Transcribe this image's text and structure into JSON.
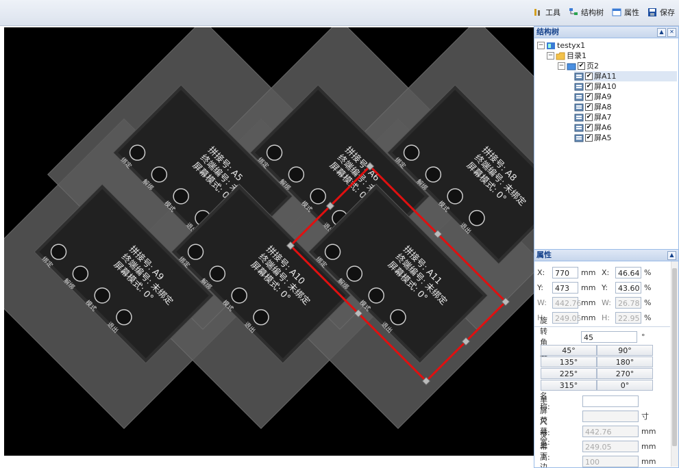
{
  "toolbar": {
    "tools_label": "工具",
    "tree_label": "结构树",
    "props_label": "属性",
    "save_label": "保存"
  },
  "structure_panel": {
    "title": "结构树",
    "root": "testyx1",
    "directory": "目录1",
    "page": "页2",
    "screens": [
      "屏A11",
      "屏A10",
      "屏A9",
      "屏A8",
      "屏A7",
      "屏A6",
      "屏A5"
    ]
  },
  "props_panel": {
    "title": "属性",
    "x_mm": "770",
    "x_pct": "46.64",
    "y_mm": "473",
    "y_pct": "43.60",
    "w_mm": "442.76",
    "w_pct": "26.78",
    "h_mm": "249.05",
    "h_pct": "22.95",
    "unit_mm": "mm",
    "unit_pct": "%",
    "x_label": "X:",
    "y_label": "Y:",
    "w_label": "W:",
    "h_label": "H:",
    "rotation_label": "旋转角度:",
    "rotation_value": "45",
    "degree_symbol": "°",
    "angle_buttons": [
      "45°",
      "90°",
      "135°",
      "180°",
      "225°",
      "270°",
      "315°",
      "0°"
    ],
    "name_label": "名称:",
    "screen_size_label": "单屏尺寸:",
    "inch_unit": "寸",
    "width_label": "荧幕宽:",
    "width_value": "442.76",
    "height_label": "荧幕高:",
    "height_value": "249.05",
    "border_label": "上下边框:",
    "border_value": "100"
  },
  "canvas": {
    "screens": [
      {
        "id": "A5",
        "l1": "拼接号: A5",
        "l2": "终端编号: 未绑定",
        "l3": "屏幕模式: 0°"
      },
      {
        "id": "A6",
        "l1": "拼接号: A6",
        "l2": "终端编号: 未绑定",
        "l3": "屏幕模式: 0°"
      },
      {
        "id": "A8",
        "l1": "拼接号: A8",
        "l2": "终端编号: 未绑定",
        "l3": "屏幕模式: 0°"
      },
      {
        "id": "A9",
        "l1": "拼接号: A9",
        "l2": "终端编号: 未绑定",
        "l3": "屏幕模式: 0°"
      },
      {
        "id": "A10",
        "l1": "拼接号: A10",
        "l2": "终端编号: 未绑定",
        "l3": "屏幕模式: 0°"
      },
      {
        "id": "A11",
        "l1": "拼接号: A11",
        "l2": "终端编号: 未绑定",
        "l3": "屏幕模式: 0°"
      }
    ],
    "btn_bind": "绑定",
    "btn_unbind": "解绑",
    "btn_mode": "模式",
    "btn_exit": "退出",
    "selection_color": "#e01010"
  }
}
